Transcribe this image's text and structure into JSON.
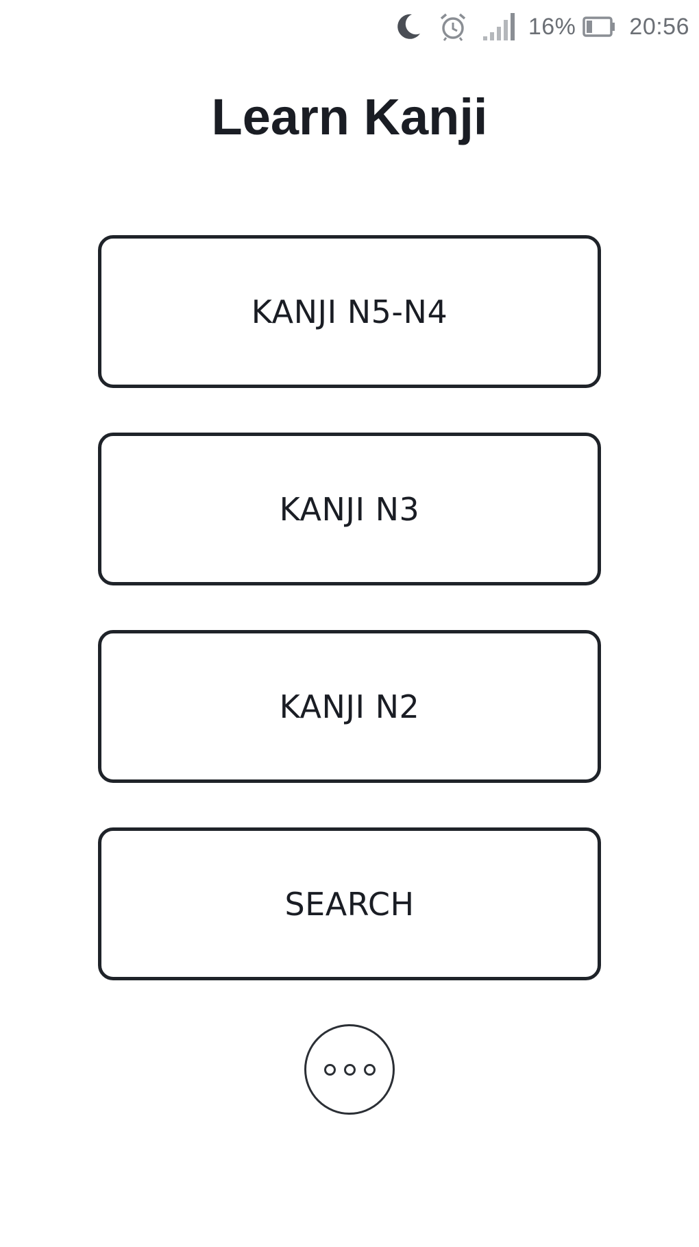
{
  "status_bar": {
    "icons": [
      "moon-icon",
      "alarm-icon",
      "signal-icon",
      "battery-icon"
    ],
    "battery_text": "16%",
    "time": "20:56"
  },
  "page": {
    "title": "Learn Kanji"
  },
  "menu": {
    "buttons": [
      {
        "label": "KANJI N5-N4"
      },
      {
        "label": "KANJI N3"
      },
      {
        "label": "KANJI N2"
      },
      {
        "label": "SEARCH"
      }
    ]
  },
  "more": {
    "icon": "more-options-icon"
  },
  "colors": {
    "background": "#ffffff",
    "text": "#1a1d24",
    "border": "#1f2329",
    "status": "#6b6f75"
  }
}
